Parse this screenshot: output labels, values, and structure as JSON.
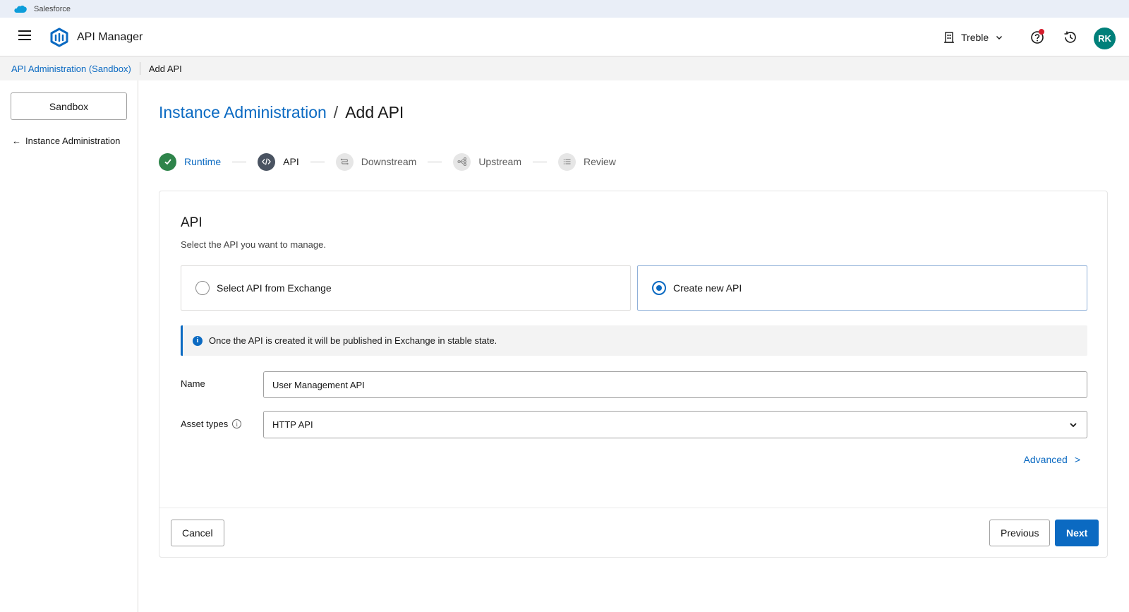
{
  "window": {
    "brand_label": "Salesforce"
  },
  "header": {
    "app_title": "API Manager",
    "org_name": "Treble",
    "user_initials": "RK",
    "help_icon": "question-circle-icon",
    "history_icon": "history-clock-icon",
    "avatar_color": "#00807a",
    "notification_color": "#d61e2e"
  },
  "breadcrumb": {
    "parent": "API Administration (Sandbox)",
    "current": "Add API"
  },
  "sidebar": {
    "environment_button": "Sandbox",
    "back_link": "Instance Administration"
  },
  "page": {
    "title_link": "Instance Administration",
    "title_separator": "/",
    "title_current": "Add API"
  },
  "stepper": {
    "steps": [
      {
        "label": "Runtime",
        "state": "done",
        "icon": "check-icon"
      },
      {
        "label": "API",
        "state": "active",
        "icon": "code-icon"
      },
      {
        "label": "Downstream",
        "state": "todo",
        "icon": "downstream-icon"
      },
      {
        "label": "Upstream",
        "state": "todo",
        "icon": "upstream-icon"
      },
      {
        "label": "Review",
        "state": "todo",
        "icon": "list-icon"
      }
    ]
  },
  "form": {
    "section_title": "API",
    "section_subtitle": "Select the API you want to manage.",
    "options": [
      {
        "label": "Select API from Exchange",
        "selected": false
      },
      {
        "label": "Create new API",
        "selected": true
      }
    ],
    "info_message": "Once the API is created it will be published in Exchange in stable state.",
    "name_label": "Name",
    "name_value": "User Management API",
    "asset_types_label": "Asset types",
    "asset_types_value": "HTTP API",
    "advanced_label": "Advanced",
    "advanced_chevron": ">"
  },
  "footer": {
    "cancel_label": "Cancel",
    "previous_label": "Previous",
    "next_label": "Next"
  },
  "colors": {
    "accent": "#0b6ac2",
    "success": "#2e844a",
    "active_step": "#4a5361"
  }
}
